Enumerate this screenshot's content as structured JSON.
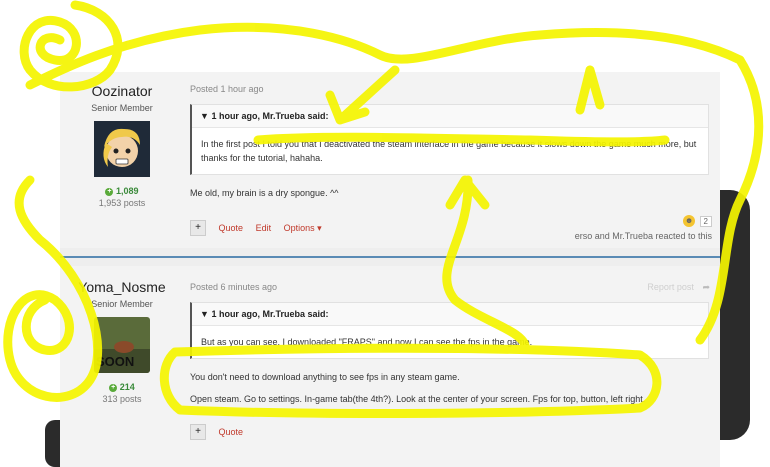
{
  "posts": [
    {
      "author": "Oozinator",
      "rank": "Senior Member",
      "reputation": "1,089",
      "post_count": "1,953 posts",
      "meta": "Posted 1 hour ago",
      "quote_header": "1 hour ago, Mr.Trueba said:",
      "quote_text": "In the first post I told you that I deactivated the steam interface in the game because it slows down the game much more, but thanks for the tutorial, hahaha.",
      "body": [
        "Me old, my brain is a dry spongue. ^^"
      ],
      "controls": [
        "Quote",
        "Edit",
        "Options ▾"
      ],
      "reaction_count": "2",
      "reaction_text": "erso and Mr.Trueba reacted to this"
    },
    {
      "author": "Yoma_Nosme",
      "rank": "Senior Member",
      "reputation": "214",
      "post_count": "313 posts",
      "meta": "Posted 6 minutes ago",
      "report": "Report post",
      "avatar_text": "SOON",
      "quote_header": "1 hour ago, Mr.Trueba said:",
      "quote_text": "But as you can see, I downloaded \"FRAPS\" and now I can see the fps in the game.",
      "body": [
        "You don't need to download anything to see fps in any steam game.",
        "Open steam. Go to settings. In-game tab(the 4th?). Look at the center of your screen. Fps for top, button, left right."
      ],
      "controls": [
        "Quote"
      ]
    }
  ],
  "colors": {
    "accent": "#c0392b",
    "scribble": "#f5f500",
    "divider": "#5a8bb5"
  }
}
